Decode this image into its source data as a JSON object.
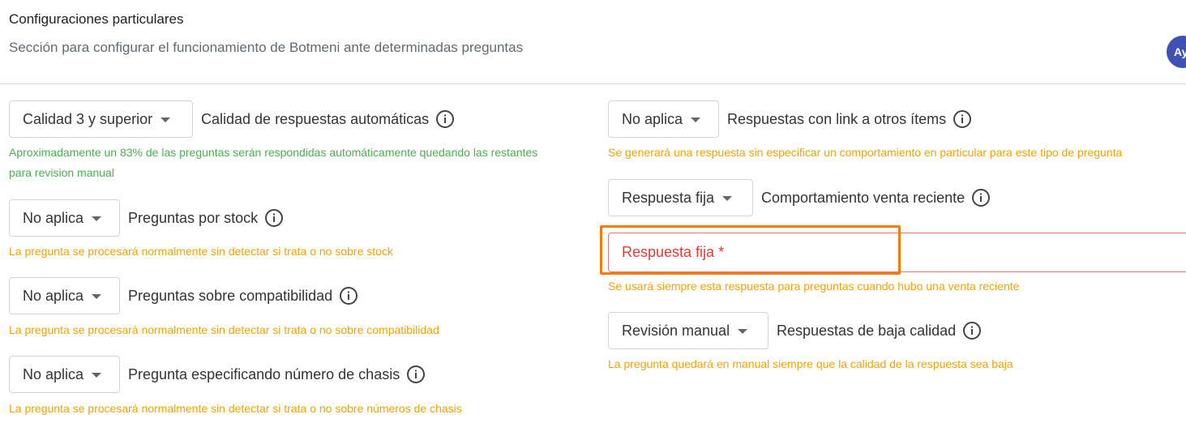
{
  "header": {
    "title": "Configuraciones particulares",
    "subtitle": "Sección para configurar el funcionamiento de Botmeni ante determinadas preguntas",
    "avatar_text": "Ay"
  },
  "left": {
    "quality": {
      "select_value": "Calidad 3 y superior",
      "label": "Calidad de respuestas automáticas",
      "help_line1": "Aproximadamente un 83% de las preguntas serán respondidas automáticamente quedando las restantes",
      "help_line2": "para revision manual"
    },
    "stock": {
      "select_value": "No aplica",
      "label": "Preguntas por stock",
      "help": "La pregunta se procesará normalmente sin detectar si trata o no sobre stock"
    },
    "compat": {
      "select_value": "No aplica",
      "label": "Preguntas sobre compatibilidad",
      "help": "La pregunta se procesará normalmente sin detectar si trata o no sobre compatibilidad"
    },
    "chassis": {
      "select_value": "No aplica",
      "label": "Pregunta especificando número de chasis",
      "help": "La pregunta se procesará normalmente sin detectar si trata o no sobre números de chasis"
    }
  },
  "right": {
    "links": {
      "select_value": "No aplica",
      "label": "Respuestas con link a otros ítems",
      "help": "Se generará una respuesta sin especificar un comportamiento en particular para este tipo de pregunta"
    },
    "recent_sale": {
      "select_value": "Respuesta fija",
      "label": "Comportamiento venta reciente",
      "field_placeholder": "Respuesta fija *",
      "help": "Se usará siempre esta respuesta para preguntas cuando hubo una venta reciente"
    },
    "low_quality": {
      "select_value": "Revisión manual",
      "label": "Respuestas de baja calidad",
      "help": "La pregunta quedará en manual siempre que la calidad de la respuesta sea baja"
    }
  },
  "colors": {
    "help_green": "#4caf50",
    "help_orange": "#f5a300",
    "error_red": "#e53935",
    "highlight_orange": "#f57c00",
    "avatar": "#3f51b5"
  }
}
